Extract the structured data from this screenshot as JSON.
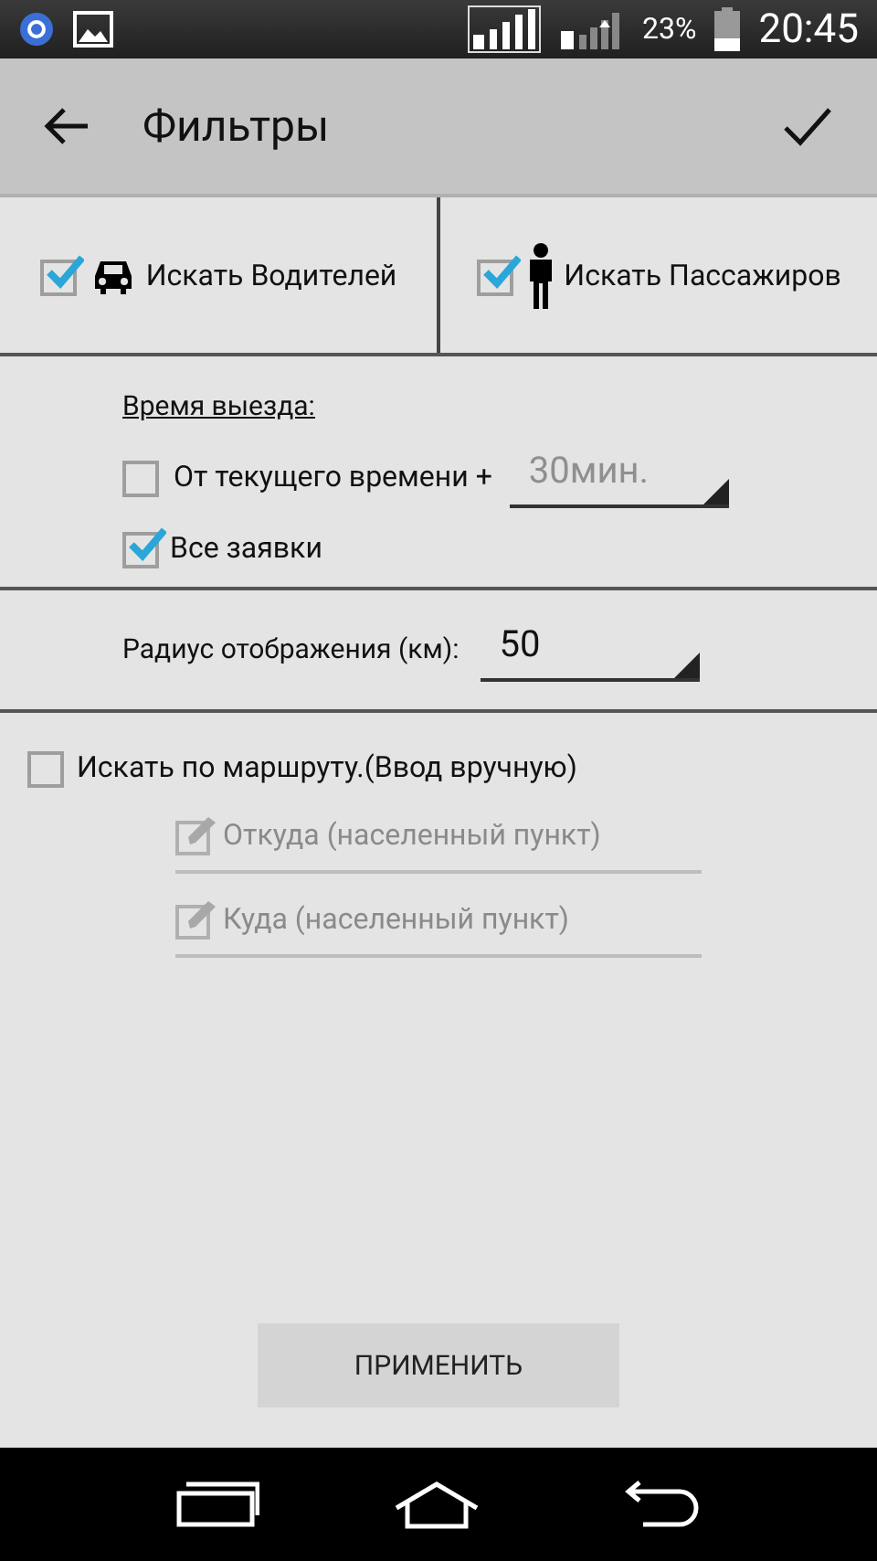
{
  "status_bar": {
    "battery": "23%",
    "time": "20:45"
  },
  "app_bar": {
    "title": "Фильтры"
  },
  "search_types": [
    {
      "kind": "car",
      "label": "Искать Водителей",
      "checked": true
    },
    {
      "kind": "person",
      "label": "Искать Пассажиров",
      "checked": true
    }
  ],
  "departure": {
    "title": "Время выезда:",
    "from_now": {
      "label": "От текущего времени +",
      "checked": false
    },
    "offset": {
      "value": "30мин.",
      "disabled": true
    },
    "all_requests": {
      "label": "Все заявки",
      "checked": true
    }
  },
  "radius": {
    "label": "Радиус отображения (км):",
    "value": "50"
  },
  "route": {
    "label": "Искать по маршруту.(Ввод вручную)",
    "checked": false,
    "fields": [
      {
        "placeholder": "Откуда (населенный пункт)"
      },
      {
        "placeholder": "Куда (населенный пункт)"
      }
    ]
  },
  "apply_button": "ПРИМЕНИТЬ"
}
